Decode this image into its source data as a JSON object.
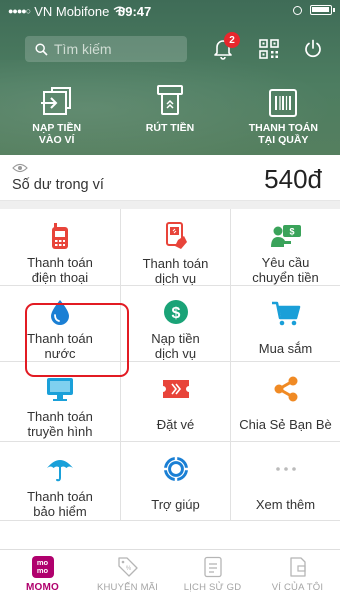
{
  "status_bar": {
    "carrier": "VN Mobifone",
    "time": "09:47"
  },
  "search": {
    "placeholder": "Tìm kiếm"
  },
  "notifications": {
    "count": "2"
  },
  "quick_actions": [
    {
      "label": "NẠP TIỀN\nVÀO VÍ",
      "icon": "wallet-deposit-icon"
    },
    {
      "label": "RÚT TIỀN",
      "icon": "withdraw-icon"
    },
    {
      "label": "THANH TOÁN\nTẠI QUẦY",
      "icon": "counter-payment-icon"
    }
  ],
  "balance": {
    "label": "Số dư trong ví",
    "value": "540đ"
  },
  "services": [
    {
      "label": "Thanh toán\nđiện thoại",
      "icon": "mobile-phone-icon",
      "color": "#e8443a"
    },
    {
      "label": "Thanh toán\ndịch vụ",
      "icon": "service-payment-icon",
      "color": "#e8443a"
    },
    {
      "label": "Yêu cầu\nchuyển tiền",
      "icon": "money-request-icon",
      "color": "#3aa35a"
    },
    {
      "label": "Thanh toán\nnước",
      "icon": "water-drop-icon",
      "color": "#1a7fd4"
    },
    {
      "label": "Nạp tiền\ndịch vụ",
      "icon": "dollar-coin-icon",
      "color": "#1aa377"
    },
    {
      "label": "Mua sắm",
      "icon": "shopping-cart-icon",
      "color": "#1a9fd8"
    },
    {
      "label": "Thanh toán\ntruyền hình",
      "icon": "tv-icon",
      "color": "#1aa0d9"
    },
    {
      "label": "Đặt vé",
      "icon": "ticket-icon",
      "color": "#e8443a"
    },
    {
      "label": "Chia Sẻ Bạn Bè",
      "icon": "share-icon",
      "color": "#f08a24"
    },
    {
      "label": "Thanh toán\nbảo hiểm",
      "icon": "umbrella-icon",
      "color": "#1aa0d9"
    },
    {
      "label": "Trợ giúp",
      "icon": "help-lifebuoy-icon",
      "color": "#1a7fd4"
    },
    {
      "label": "Xem thêm",
      "icon": "more-dots-icon",
      "color": "#bbbbbb"
    }
  ],
  "bottom_nav": [
    {
      "label": "MOMO",
      "logo": "mo\nmo"
    },
    {
      "label": "KHUYẾN MÃI"
    },
    {
      "label": "LỊCH SỬ GD"
    },
    {
      "label": "VÍ CỦA TÔI"
    }
  ],
  "colors": {
    "header": "#4d7d61",
    "brand": "#b0006d",
    "highlight": "#e21b23"
  }
}
